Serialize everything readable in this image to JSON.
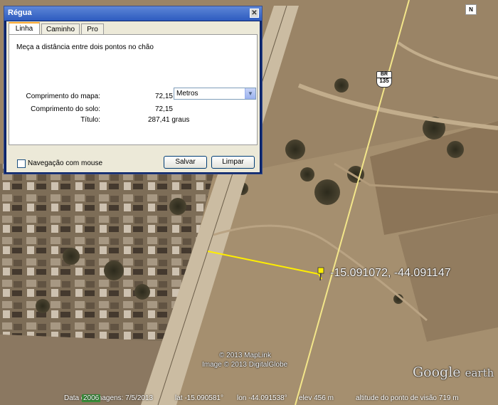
{
  "dialog": {
    "title": "Régua",
    "close_glyph": "✕",
    "tabs": [
      "Linha",
      "Caminho",
      "Pro"
    ],
    "description": "Meça a distância entre dois pontos no chão",
    "map_length_label": "Comprimento do mapa:",
    "map_length_value": "72,15",
    "unit": "Metros",
    "ground_length_label": "Comprimento do solo:",
    "ground_length_value": "72,15",
    "heading_label": "Título:",
    "heading_value": "287,41 graus",
    "mouse_nav_label": "Navegação com mouse",
    "save_label": "Salvar",
    "clear_label": "Limpar"
  },
  "map": {
    "coordinate_label": "-15.091072, -44.091147",
    "road_shield_top": "BR",
    "road_shield_number": "135",
    "north_label": "N",
    "copyright_1": "© 2013 MapLink",
    "copyright_2": "Image © 2013 DigitalGlobe",
    "brand_google": "Google",
    "brand_earth": "earth",
    "colors": {
      "measure_line": "#ffee00",
      "road_line": "#f3e68a"
    }
  },
  "status": {
    "imagery_date": "Data das imagens: 7/5/2013",
    "year_badge": "2006",
    "lat": "lat -15.090581°",
    "lon": "lon -44.091538°",
    "elev": "elev 456 m",
    "eye_alt": "altitude do ponto de visão 719 m"
  }
}
